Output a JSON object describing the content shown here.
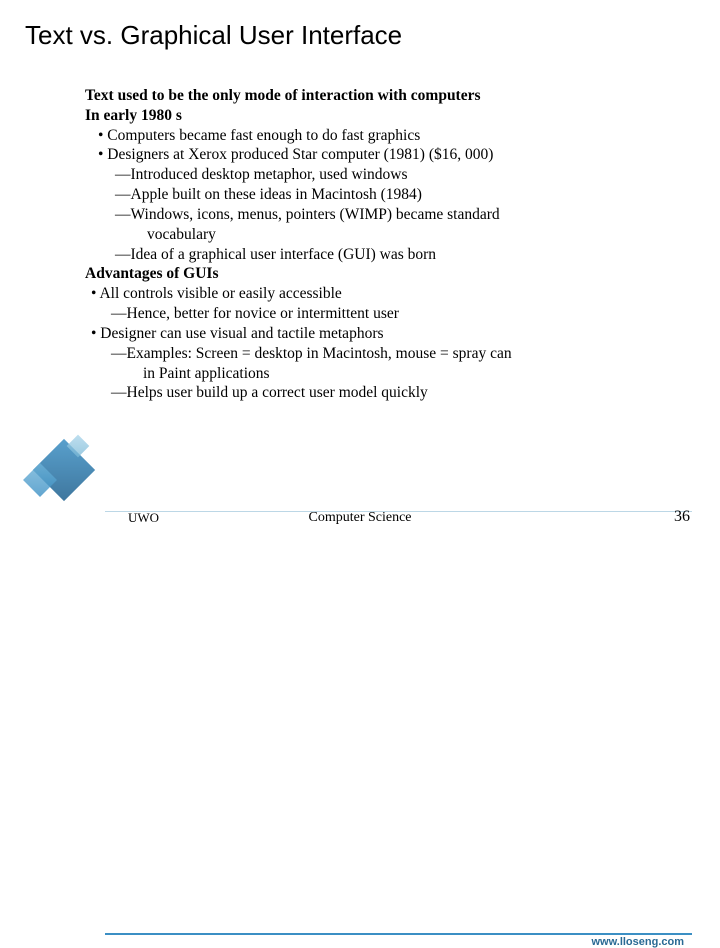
{
  "title": "Text vs. Graphical User Interface",
  "body": {
    "line1": "Text used to be the only mode of interaction with computers",
    "line2": "In early 1980 s",
    "bullet1": "•  Computers became fast enough to do fast graphics",
    "bullet2": "•  Designers at Xerox produced Star computer (1981) ($16, 000)",
    "sub1": "—Introduced desktop metaphor, used windows",
    "sub2": "—Apple built on these ideas in Macintosh (1984)",
    "sub3": "—Windows, icons, menus, pointers (WIMP) became standard",
    "sub3b": "vocabulary",
    "sub4": "—Idea of a graphical user interface (GUI) was born",
    "adv": "Advantages of GUIs",
    "abullet1": "•  All controls visible or easily accessible",
    "asub1": "—Hence, better for novice or intermittent user",
    "abullet2": "•  Designer can use visual and tactile metaphors",
    "asub2": "—Examples: Screen = desktop in Macintosh, mouse = spray can",
    "asub2b": "in Paint applications",
    "asub3": "—Helps user build up a correct user model quickly"
  },
  "footer": {
    "url": "www.lloseng.com",
    "left": "UWO",
    "center": "Computer Science",
    "page": "36"
  }
}
